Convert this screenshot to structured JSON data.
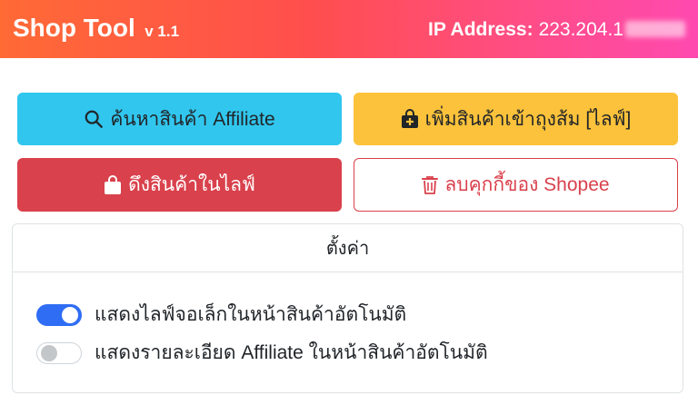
{
  "header": {
    "title": "Shop Tool",
    "version": "v 1.1",
    "ip_label": "IP Address:",
    "ip_value": "223.204.1"
  },
  "actions": {
    "search_affiliate": "ค้นหาสินค้า Affiliate",
    "add_to_cart_live": "เพิ่มสินค้าเข้าถุงส้ม [ไลฟ์]",
    "pull_live_products": "ดึงสินค้าในไลฟ์",
    "clear_shopee_cookies": "ลบคุกกี้ของ Shopee"
  },
  "settings": {
    "title": "ตั้งค่า",
    "items": [
      {
        "label": "แสดงไลฟ์จอเล็กในหน้าสินค้าอัตโนมัติ",
        "enabled": true
      },
      {
        "label": "แสดงรายละเอียด Affiliate ในหน้าสินค้าอัตโนมัติ",
        "enabled": false
      }
    ]
  },
  "colors": {
    "info": "#31c6ee",
    "warning": "#fcc23b",
    "danger": "#d9414c",
    "toggle_on": "#2f6df5"
  },
  "icons": {
    "search": "search-icon",
    "add": "bag-plus-icon",
    "pull": "shopping-bag-icon",
    "clear": "trash-icon"
  }
}
